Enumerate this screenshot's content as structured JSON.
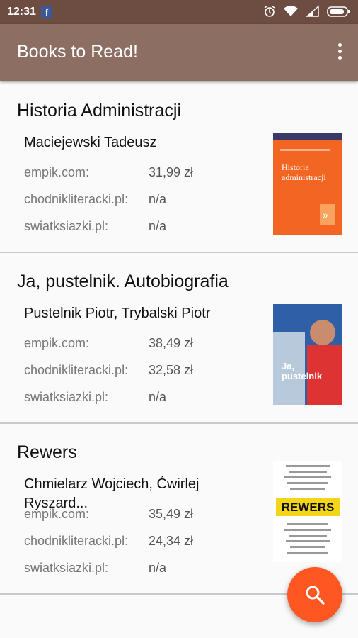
{
  "status": {
    "time": "12:31",
    "fb": "f"
  },
  "appbar": {
    "title": "Books to Read!"
  },
  "books": [
    {
      "title": "Historia Administracji",
      "author": "Maciejewski Tadeusz",
      "prices": [
        {
          "store": "empik.com:",
          "price": "31,99 zł"
        },
        {
          "store": "chodnikliteracki.pl:",
          "price": "n/a"
        },
        {
          "store": "swiatksiazki.pl:",
          "price": "n/a"
        }
      ],
      "cover": {
        "bg": "#f26522",
        "line1": "Historia",
        "line2": "administracji"
      }
    },
    {
      "title": "Ja, pustelnik. Autobiografia",
      "author": "Pustelnik Piotr, Trybalski Piotr",
      "prices": [
        {
          "store": "empik.com:",
          "price": "38,49 zł"
        },
        {
          "store": "chodnikliteracki.pl:",
          "price": "32,58 zł"
        },
        {
          "store": "swiatksiazki.pl:",
          "price": "n/a"
        }
      ],
      "cover": {
        "bg": "#2f5fa6",
        "line1": "Ja,",
        "line2": "pustelnik"
      }
    },
    {
      "title": "Rewers",
      "author": "Chmielarz Wojciech, Ćwirlej Ryszard...",
      "prices": [
        {
          "store": "empik.com:",
          "price": "35,49 zł"
        },
        {
          "store": "chodnikliteracki.pl:",
          "price": "24,34 zł"
        },
        {
          "store": "swiatksiazki.pl:",
          "price": "n/a"
        }
      ],
      "cover": {
        "bg": "#ffffff",
        "line1": "REWERS",
        "line2": ""
      }
    }
  ],
  "colors": {
    "statusbar": "#6d4c41",
    "appbar": "#8d6e63",
    "fab": "#ff5722"
  }
}
